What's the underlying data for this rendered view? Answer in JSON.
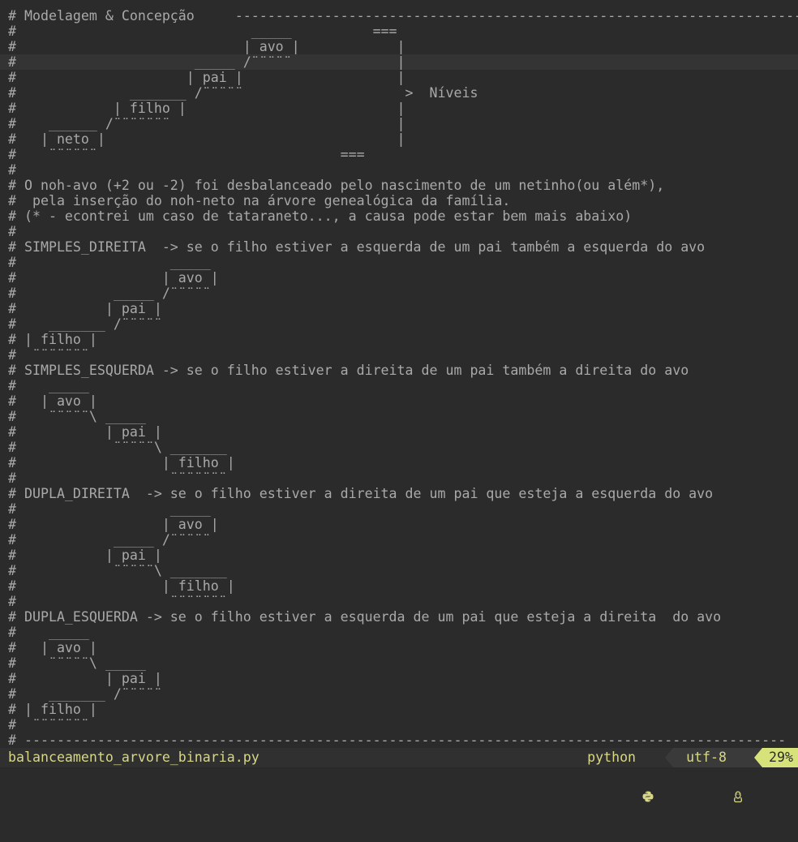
{
  "editor": {
    "lines": [
      "# Modelagem & Concepção     -----------------------------------------------------------------------------------",
      "#                             _____          ===",
      "#                            | avo |            |",
      "#                      _____ /¨¨¨¨¨             |",
      "#                     | pai |                   |",
      "#              _______ /¨¨¨¨¨                    >  Níveis",
      "#            | filho |                          |",
      "#    ______ /¨¨¨¨¨¨¨                            |",
      "#   | neto |                                    |",
      "#    ¨¨¨¨¨¨                              ===",
      "#",
      "# O noh-avo (+2 ou -2) foi desbalanceado pelo nascimento de um netinho(ou além*),",
      "#  pela inserção do noh-neto na árvore genealógica da família.",
      "# (* - econtrei um caso de tataraneto..., a causa pode estar bem mais abaixo)",
      "#",
      "# SIMPLES_DIREITA  -> se o filho estiver a esquerda de um pai também a esquerda do avo",
      "#                   _____",
      "#                  | avo |",
      "#            _____ /¨¨¨¨¨",
      "#           | pai |",
      "#    _______ /¨¨¨¨¨",
      "# | filho |",
      "#  ¨¨¨¨¨¨¨",
      "# SIMPLES_ESQUERDA -> se o filho estiver a direita de um pai também a direita do avo",
      "#    _____",
      "#   | avo |",
      "#    ¨¨¨¨¨\\ _____",
      "#           | pai |",
      "#            ¨¨¨¨¨\\ _______",
      "#                  | filho |",
      "#                   ¨¨¨¨¨¨¨",
      "# DUPLA_DIREITA  -> se o filho estiver a direita de um pai que esteja a esquerda do avo",
      "#                   _____",
      "#                  | avo |",
      "#            _____ /¨¨¨¨¨",
      "#           | pai |",
      "#            ¨¨¨¨¨\\ _______",
      "#                  | filho |",
      "#                   ¨¨¨¨¨¨¨",
      "# DUPLA_ESQUERDA -> se o filho estiver a esquerda de um pai que esteja a direita  do avo",
      "#    _____",
      "#   | avo |",
      "#    ¨¨¨¨¨\\ _____",
      "#           | pai |",
      "#    _______ /¨¨¨¨¨",
      "# | filho |",
      "#  ¨¨¨¨¨¨¨",
      "# ----------------------------------------------------------------------------------------------"
    ],
    "cursor_line": 3
  },
  "statusbar": {
    "filename": "balanceamento_arvore_binaria.py",
    "filetype": "python",
    "filetype_icon": "python-icon",
    "encoding": "utf-8",
    "os_icon": "linux-tux-icon",
    "percent": "29%"
  },
  "colors": {
    "background": "#2b2b2b",
    "text": "#a9a9a9",
    "status_bg": "#303030",
    "status_text": "#d7d787",
    "accent": "#d7e37a"
  }
}
